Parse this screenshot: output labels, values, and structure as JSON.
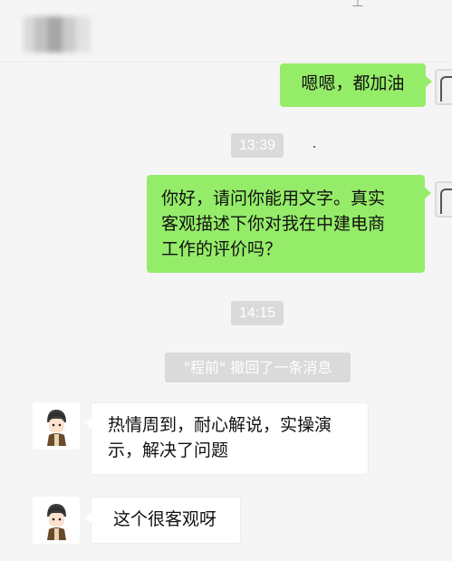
{
  "top_icon": "⊥",
  "messages": {
    "m1": "嗯嗯，都加油",
    "m2_line1": "你好，请问你能用文字。真实",
    "m2_line2": "客观描述下你对我在中建电商",
    "m2_line3": "工作的评价吗？",
    "m3_line1": "热情周到，耐心解说，实操演",
    "m3_line2": "示，解决了问题",
    "m4": "这个很客观呀"
  },
  "times": {
    "t1": "13:39",
    "t2": "14:15"
  },
  "recall_notice": "\"程前\" 撤回了一条消息",
  "colors": {
    "my_bubble": "#95ec69",
    "other_bubble": "#ffffff",
    "background": "#f5f5f5",
    "tag_bg": "#dadada"
  },
  "icons": {
    "my_avatar": "person-sketch-avatar",
    "other_avatar": "cartoon-boy-avatar"
  }
}
